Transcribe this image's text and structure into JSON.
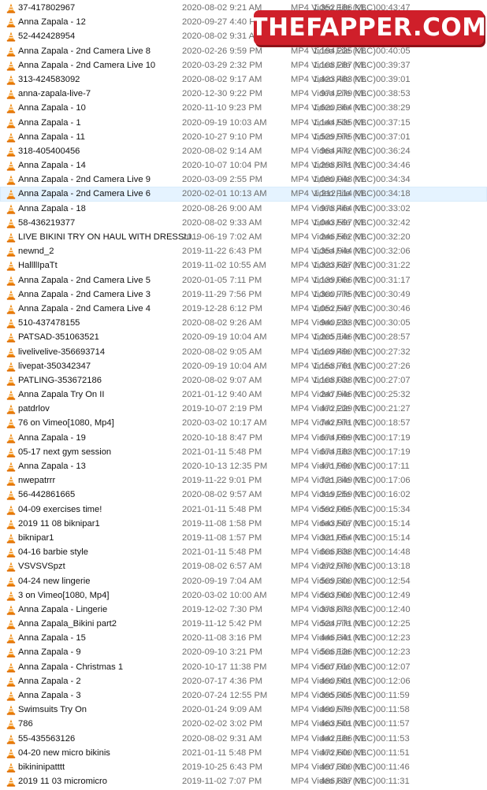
{
  "selected_index": 13,
  "colors": {
    "selection_bg": "#e5f3ff",
    "watermark_bg": "#cf1f2a",
    "icon": "vlc-cone-orange"
  },
  "watermark": {
    "text": "THEFAPPER.COM"
  },
  "files": [
    {
      "name": "37-417802967",
      "date": "2020-08-02 9:21 AM",
      "type": "MP4 Video File (VLC)",
      "size": "1,352,186 KB",
      "length": "00:43:47"
    },
    {
      "name": "Anna Zapala - 12",
      "date": "2020-09-27 4:40 PM",
      "type": "",
      "size": "",
      "length": ""
    },
    {
      "name": "52-442428954",
      "date": "2020-08-02 9:31 AM",
      "type": "",
      "size": "",
      "length": ""
    },
    {
      "name": "Anna Zapala - 2nd Camera Live 8",
      "date": "2020-02-26 9:59 PM",
      "type": "MP4 Video File (VLC)",
      "size": "1,194,225 KB",
      "length": "00:40:05"
    },
    {
      "name": "Anna Zapala - 2nd Camera Live 10",
      "date": "2020-03-29 2:32 PM",
      "type": "MP4 Video File (VLC)",
      "size": "1,108,287 KB",
      "length": "00:39:37"
    },
    {
      "name": "313-424583092",
      "date": "2020-08-02 9:17 AM",
      "type": "MP4 Video File (VLC)",
      "size": "1,423,483 KB",
      "length": "00:39:01"
    },
    {
      "name": "anna-zapala-live-7",
      "date": "2020-12-30 9:22 PM",
      "type": "MP4 Video File (VLC)",
      "size": "974,279 KB",
      "length": "00:38:53"
    },
    {
      "name": "Anna Zapala - 10",
      "date": "2020-11-10 9:23 PM",
      "type": "MP4 Video File (VLC)",
      "size": "1,620,364 KB",
      "length": "00:38:29"
    },
    {
      "name": "Anna Zapala - 1",
      "date": "2020-09-19 10:03 AM",
      "type": "MP4 Video File (VLC)",
      "size": "1,144,535 KB",
      "length": "00:37:15"
    },
    {
      "name": "Anna Zapala - 11",
      "date": "2020-10-27 9:10 PM",
      "type": "MP4 Video File (VLC)",
      "size": "1,529,975 KB",
      "length": "00:37:01"
    },
    {
      "name": "318-405400456",
      "date": "2020-08-02 9:14 AM",
      "type": "MP4 Video File (VLC)",
      "size": "964,472 KB",
      "length": "00:36:24"
    },
    {
      "name": "Anna Zapala - 14",
      "date": "2020-10-07 10:04 PM",
      "type": "MP4 Video File (VLC)",
      "size": "1,298,871 KB",
      "length": "00:34:46"
    },
    {
      "name": "Anna Zapala - 2nd Camera Live 9",
      "date": "2020-03-09 2:55 PM",
      "type": "MP4 Video File (VLC)",
      "size": "1,080,048 KB",
      "length": "00:34:34"
    },
    {
      "name": "Anna Zapala - 2nd Camera Live 6",
      "date": "2020-02-01 10:13 AM",
      "type": "MP4 Video File (VLC)",
      "size": "1,212,114 KB",
      "length": "00:34:18"
    },
    {
      "name": "Anna Zapala - 18",
      "date": "2020-08-26 9:00 AM",
      "type": "MP4 Video File (VLC)",
      "size": "978,464 KB",
      "length": "00:33:02"
    },
    {
      "name": "58-436219377",
      "date": "2020-08-02 9:33 AM",
      "type": "MP4 Video File (VLC)",
      "size": "1,043,597 KB",
      "length": "00:32:42"
    },
    {
      "name": "LIVE  BIKINI TRY ON HAUL WITH DRESSLI...",
      "date": "2019-06-19 7:02 AM",
      "type": "MP4 Video File (VLC)",
      "size": "246,562 KB",
      "length": "00:32:20"
    },
    {
      "name": "newnd_2",
      "date": "2019-11-22 6:43 PM",
      "type": "MP4 Video File (VLC)",
      "size": "1,354,944 KB",
      "length": "00:32:06"
    },
    {
      "name": "HallllIpaTt",
      "date": "2019-11-02 10:55 AM",
      "type": "MP4 Video File (VLC)",
      "size": "1,323,627 KB",
      "length": "00:31:22"
    },
    {
      "name": "Anna Zapala - 2nd Camera Live 5",
      "date": "2020-01-05 7:11 PM",
      "type": "MP4 Video File (VLC)",
      "size": "1,139,066 KB",
      "length": "00:31:17"
    },
    {
      "name": "Anna Zapala - 2nd Camera Live 3",
      "date": "2019-11-29 7:56 PM",
      "type": "MP4 Video File (VLC)",
      "size": "1,300,775 KB",
      "length": "00:30:49"
    },
    {
      "name": "Anna Zapala - 2nd Camera Live 4",
      "date": "2019-12-28 6:12 PM",
      "type": "MP4 Video File (VLC)",
      "size": "1,052,547 KB",
      "length": "00:30:46"
    },
    {
      "name": "510-437478155",
      "date": "2020-08-02 9:26 AM",
      "type": "MP4 Video File (VLC)",
      "size": "940,233 KB",
      "length": "00:30:05"
    },
    {
      "name": "PATSAD-351063521",
      "date": "2020-09-19 10:04 AM",
      "type": "MP4 Video File (VLC)",
      "size": "1,205,146 KB",
      "length": "00:28:57"
    },
    {
      "name": "livelivelive-356693714",
      "date": "2020-08-02 9:05 AM",
      "type": "MP4 Video File (VLC)",
      "size": "1,109,490 KB",
      "length": "00:27:32"
    },
    {
      "name": "livepat-350342347",
      "date": "2020-09-19 10:04 AM",
      "type": "MP4 Video File (VLC)",
      "size": "1,158,761 KB",
      "length": "00:27:26"
    },
    {
      "name": "PATLING-353672186",
      "date": "2020-08-02 9:07 AM",
      "type": "MP4 Video File (VLC)",
      "size": "1,108,038 KB",
      "length": "00:27:07"
    },
    {
      "name": "Anna Zapala Try On II",
      "date": "2021-01-12 9:40 AM",
      "type": "MP4 Video File (VLC)",
      "size": "247,946 KB",
      "length": "00:25:32"
    },
    {
      "name": "patdrlov",
      "date": "2019-10-07 2:19 PM",
      "type": "MP4 Video File (VLC)",
      "size": "472,229 KB",
      "length": "00:21:27"
    },
    {
      "name": "76 on Vimeo[1080, Mp4]",
      "date": "2020-03-02 10:17 AM",
      "type": "MP4 Video File (VLC)",
      "size": "742,971 KB",
      "length": "00:18:57"
    },
    {
      "name": "Anna Zapala - 19",
      "date": "2020-10-18 8:47 PM",
      "type": "MP4 Video File (VLC)",
      "size": "674,099 KB",
      "length": "00:17:19"
    },
    {
      "name": "05-17 next gym session",
      "date": "2021-01-11 5:48 PM",
      "type": "MP4 Video File (VLC)",
      "size": "674,183 KB",
      "length": "00:17:19"
    },
    {
      "name": "Anna Zapala - 13",
      "date": "2020-10-13 12:35 PM",
      "type": "MP4 Video File (VLC)",
      "size": "471,990 KB",
      "length": "00:17:11"
    },
    {
      "name": "nwepatrrr",
      "date": "2019-11-22 9:01 PM",
      "type": "MP4 Video File (VLC)",
      "size": "721,349 KB",
      "length": "00:17:06"
    },
    {
      "name": "56-442861665",
      "date": "2020-08-02 9:57 AM",
      "type": "MP4 Video File (VLC)",
      "size": "319,259 KB",
      "length": "00:16:02"
    },
    {
      "name": "04-09 exercises time!",
      "date": "2021-01-11 5:48 PM",
      "type": "MP4 Video File (VLC)",
      "size": "592,095 KB",
      "length": "00:15:34"
    },
    {
      "name": "2019 11 08 biknipar1",
      "date": "2019-11-08 1:58 PM",
      "type": "MP4 Video File (VLC)",
      "size": "643,507 KB",
      "length": "00:15:14"
    },
    {
      "name": "biknipar1",
      "date": "2019-11-08 1:57 PM",
      "type": "MP4 Video File (VLC)",
      "size": "321,054 KB",
      "length": "00:15:14"
    },
    {
      "name": "04-16 barbie style",
      "date": "2021-01-11 5:48 PM",
      "type": "MP4 Video File (VLC)",
      "size": "606,838 KB",
      "length": "00:14:48"
    },
    {
      "name": "VSVSVSpzt",
      "date": "2019-08-02 6:57 AM",
      "type": "MP4 Video File (VLC)",
      "size": "272,970 KB",
      "length": "00:13:18"
    },
    {
      "name": "04-24 new lingerie",
      "date": "2020-09-19 7:04 AM",
      "type": "MP4 Video File (VLC)",
      "size": "509,300 KB",
      "length": "00:12:54"
    },
    {
      "name": "3 on Vimeo[1080, Mp4]",
      "date": "2020-03-02 10:00 AM",
      "type": "MP4 Video File (VLC)",
      "size": "503,900 KB",
      "length": "00:12:49"
    },
    {
      "name": "Anna Zapala - Lingerie",
      "date": "2019-12-02 7:30 PM",
      "type": "MP4 Video File (VLC)",
      "size": "378,873 KB",
      "length": "00:12:40"
    },
    {
      "name": "Anna Zapala_Bikini part2",
      "date": "2019-11-12 5:42 PM",
      "type": "MP4 Video File (VLC)",
      "size": "524,771 KB",
      "length": "00:12:25"
    },
    {
      "name": "Anna Zapala - 15",
      "date": "2020-11-08 3:16 PM",
      "type": "MP4 Video File (VLC)",
      "size": "446,341 KB",
      "length": "00:12:23"
    },
    {
      "name": "Anna Zapala - 9",
      "date": "2020-09-10 3:21 PM",
      "type": "MP4 Video File (VLC)",
      "size": "506,126 KB",
      "length": "00:12:23"
    },
    {
      "name": "Anna Zapala - Christmas 1",
      "date": "2020-10-17 11:38 PM",
      "type": "MP4 Video File (VLC)",
      "size": "507,010 KB",
      "length": "00:12:07"
    },
    {
      "name": "Anna Zapala - 2",
      "date": "2020-07-17 4:36 PM",
      "type": "MP4 Video File (VLC)",
      "size": "490,901 KB",
      "length": "00:12:06"
    },
    {
      "name": "Anna Zapala - 3",
      "date": "2020-07-24 12:55 PM",
      "type": "MP4 Video File (VLC)",
      "size": "395,305 KB",
      "length": "00:11:59"
    },
    {
      "name": "Swimsuits Try On",
      "date": "2020-01-24 9:09 AM",
      "type": "MP4 Video File (VLC)",
      "size": "490,579 KB",
      "length": "00:11:58"
    },
    {
      "name": "786",
      "date": "2020-02-02 3:02 PM",
      "type": "MP4 Video File (VLC)",
      "size": "463,501 KB",
      "length": "00:11:57"
    },
    {
      "name": "55-435563126",
      "date": "2020-08-02 9:31 AM",
      "type": "MP4 Video File (VLC)",
      "size": "442,186 KB",
      "length": "00:11:53"
    },
    {
      "name": "04-20 new micro bikinis",
      "date": "2021-01-11 5:48 PM",
      "type": "MP4 Video File (VLC)",
      "size": "472,600 KB",
      "length": "00:11:51"
    },
    {
      "name": "bikininipatttt",
      "date": "2019-10-25 6:43 PM",
      "type": "MP4 Video File (VLC)",
      "size": "497,300 KB",
      "length": "00:11:46"
    },
    {
      "name": "2019 11 03 micromicro",
      "date": "2019-11-02 7:07 PM",
      "type": "MP4 Video File (VLC)",
      "size": "486,837 KB",
      "length": "00:11:31"
    }
  ]
}
